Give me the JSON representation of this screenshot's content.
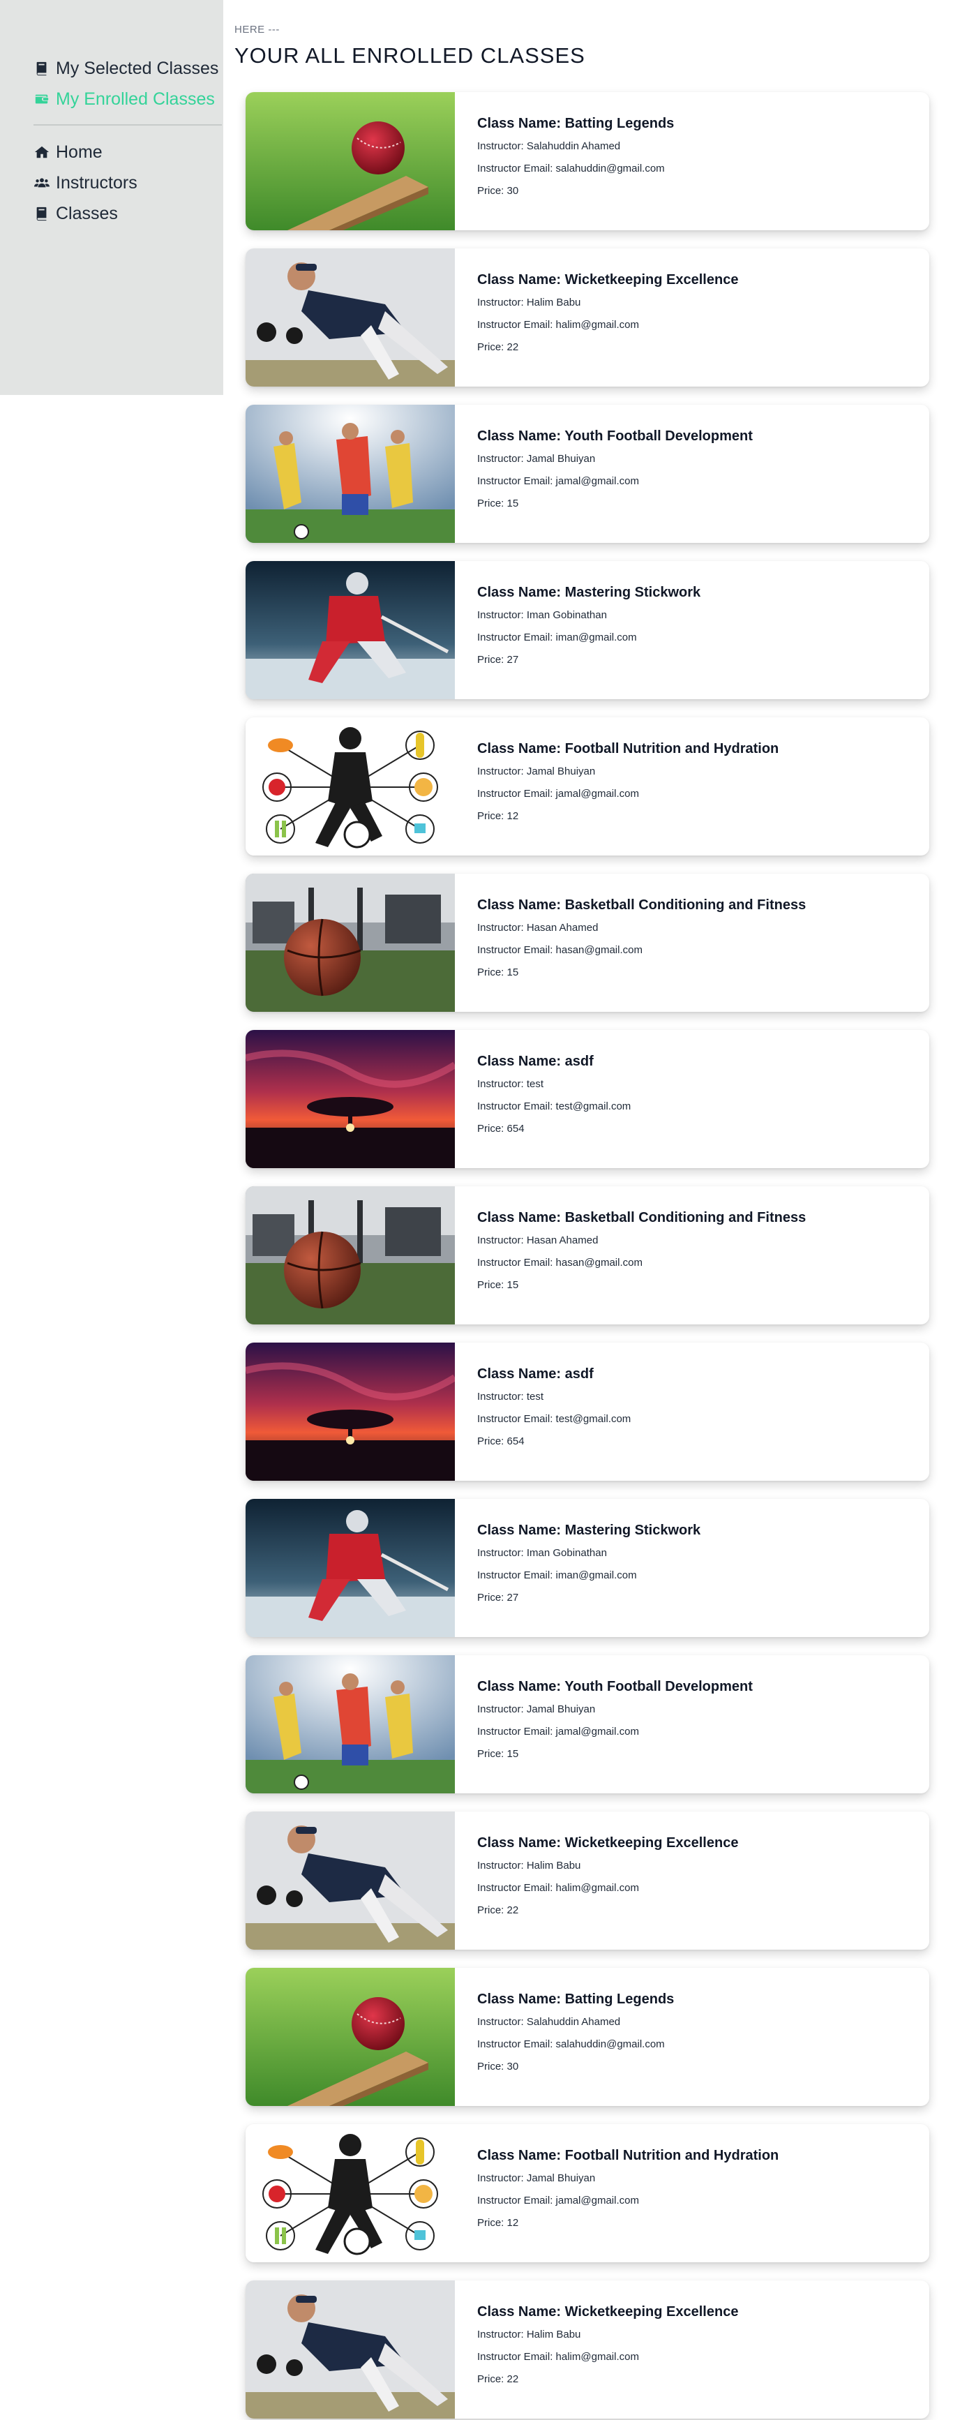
{
  "sidebar": {
    "items": [
      {
        "label": "My Selected Classes",
        "icon": "book-icon"
      },
      {
        "label": "My Enrolled Classes",
        "icon": "wallet-icon"
      }
    ],
    "nav": [
      {
        "label": "Home",
        "icon": "home-icon"
      },
      {
        "label": "Instructors",
        "icon": "users-icon"
      },
      {
        "label": "Classes",
        "icon": "book-icon"
      }
    ],
    "active_color": "#34d399"
  },
  "header": {
    "breadcrumb": "HERE ---",
    "title": "YOUR ALL ENROLLED CLASSES"
  },
  "labels": {
    "class_name": "Class Name: ",
    "instructor": "Instructor: ",
    "email": "Instructor Email: ",
    "price": "Price: "
  },
  "classes": [
    {
      "name": "Batting Legends",
      "instructor": "Salahuddin Ahamed",
      "email": "salahuddin@gmail.com",
      "price": "30",
      "image": "cricket-ball-bat"
    },
    {
      "name": "Wicketkeeping Excellence",
      "instructor": "Halim Babu",
      "email": "halim@gmail.com",
      "price": "22",
      "image": "wicketkeeper"
    },
    {
      "name": "Youth Football Development",
      "instructor": "Jamal Bhuiyan",
      "email": "jamal@gmail.com",
      "price": "15",
      "image": "football-players"
    },
    {
      "name": "Mastering Stickwork",
      "instructor": "Iman Gobinathan",
      "email": "iman@gmail.com",
      "price": "27",
      "image": "hockey-player"
    },
    {
      "name": "Football Nutrition and Hydration",
      "instructor": "Jamal Bhuiyan",
      "email": "jamal@gmail.com",
      "price": "12",
      "image": "nutrition-diagram"
    },
    {
      "name": "Basketball Conditioning and Fitness",
      "instructor": "Hasan Ahamed",
      "email": "hasan@gmail.com",
      "price": "15",
      "image": "basketball-gym"
    },
    {
      "name": "asdf",
      "instructor": "test",
      "email": "test@gmail.com",
      "price": "654",
      "image": "sunset-tree"
    },
    {
      "name": "Basketball Conditioning and Fitness",
      "instructor": "Hasan Ahamed",
      "email": "hasan@gmail.com",
      "price": "15",
      "image": "basketball-gym"
    },
    {
      "name": "asdf",
      "instructor": "test",
      "email": "test@gmail.com",
      "price": "654",
      "image": "sunset-tree"
    },
    {
      "name": "Mastering Stickwork",
      "instructor": "Iman Gobinathan",
      "email": "iman@gmail.com",
      "price": "27",
      "image": "hockey-player"
    },
    {
      "name": "Youth Football Development",
      "instructor": "Jamal Bhuiyan",
      "email": "jamal@gmail.com",
      "price": "15",
      "image": "football-players"
    },
    {
      "name": "Wicketkeeping Excellence",
      "instructor": "Halim Babu",
      "email": "halim@gmail.com",
      "price": "22",
      "image": "wicketkeeper"
    },
    {
      "name": "Batting Legends",
      "instructor": "Salahuddin Ahamed",
      "email": "salahuddin@gmail.com",
      "price": "30",
      "image": "cricket-ball-bat"
    },
    {
      "name": "Football Nutrition and Hydration",
      "instructor": "Jamal Bhuiyan",
      "email": "jamal@gmail.com",
      "price": "12",
      "image": "nutrition-diagram"
    },
    {
      "name": "Wicketkeeping Excellence",
      "instructor": "Halim Babu",
      "email": "halim@gmail.com",
      "price": "22",
      "image": "wicketkeeper"
    }
  ]
}
